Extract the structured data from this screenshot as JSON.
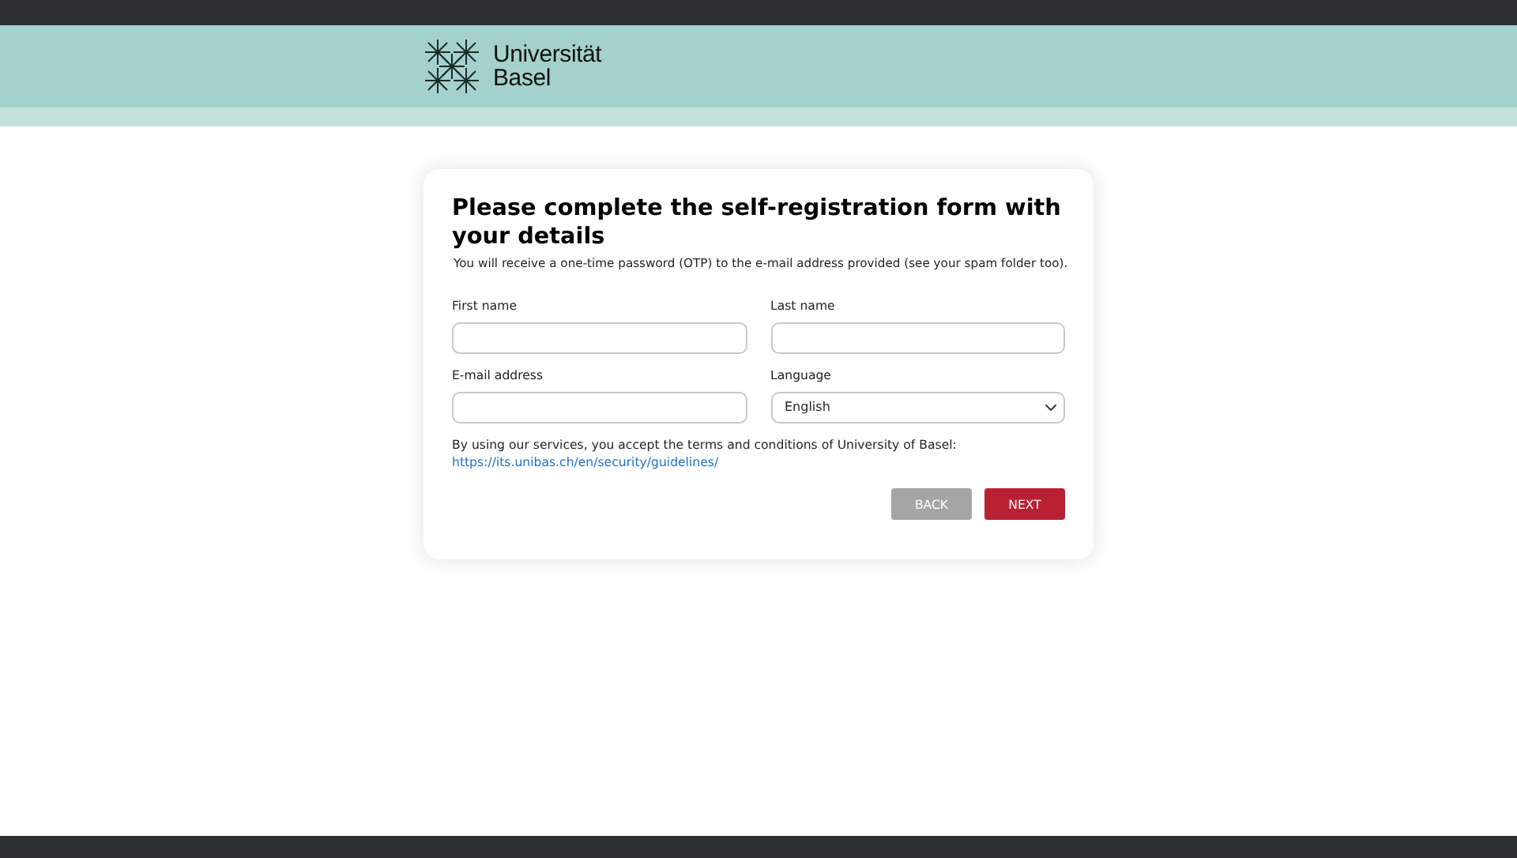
{
  "header": {
    "logo_lines": [
      "Universität",
      "Basel"
    ]
  },
  "form": {
    "title": "Please complete the self-registration form with your details",
    "subtitle": "You will receive a one-time password (OTP) to the e-mail address provided (see your spam folder too).",
    "fields": [
      {
        "kind": "text",
        "label": "First name"
      },
      {
        "kind": "text",
        "label": "Last name"
      },
      {
        "kind": "text",
        "label": "E-mail address"
      },
      {
        "kind": "select",
        "label": "Language",
        "value": "English"
      }
    ],
    "terms": "By using our services, you accept the terms and conditions of University of Basel:",
    "terms_link": "https://its.unibas.ch/en/security/guidelines/",
    "buttons": [
      {
        "label": "BACK",
        "kind": "secondary"
      },
      {
        "label": "NEXT",
        "kind": "primary"
      }
    ]
  }
}
